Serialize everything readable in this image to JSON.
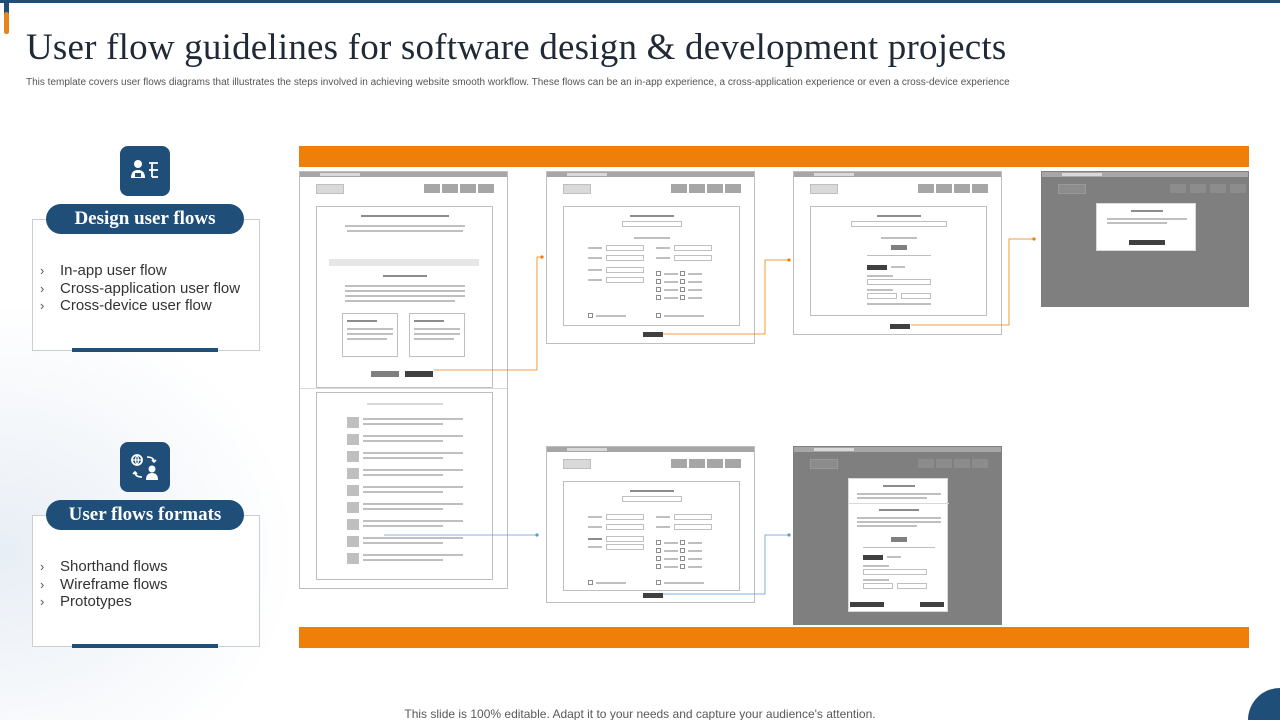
{
  "slide": {
    "title": "User flow guidelines for software design & development projects",
    "subtitle": "This template covers user flows diagrams that illustrates the steps involved in achieving website smooth workflow. These flows can be an in-app experience, a cross-application experience or even a cross-device experience",
    "footer": "This slide is 100% editable. Adapt it to your needs and capture your audience's attention."
  },
  "cards": [
    {
      "heading": "Design user flows",
      "icon": "user-flow-icon",
      "items": [
        "In-app user flow",
        "Cross-application user flow",
        "Cross-device user flow"
      ]
    },
    {
      "heading": "User flows formats",
      "icon": "user-exchange-icon",
      "items": [
        "Shorthand flows",
        "Wireframe flows",
        "Prototypes"
      ]
    }
  ],
  "colors": {
    "primary": "#1f4e79",
    "accent": "#f07f09",
    "connector_orange": "#f07f09",
    "connector_blue": "#5b9bd5",
    "wireframe_gray": "#7f7f7f"
  },
  "list_marker": "›"
}
